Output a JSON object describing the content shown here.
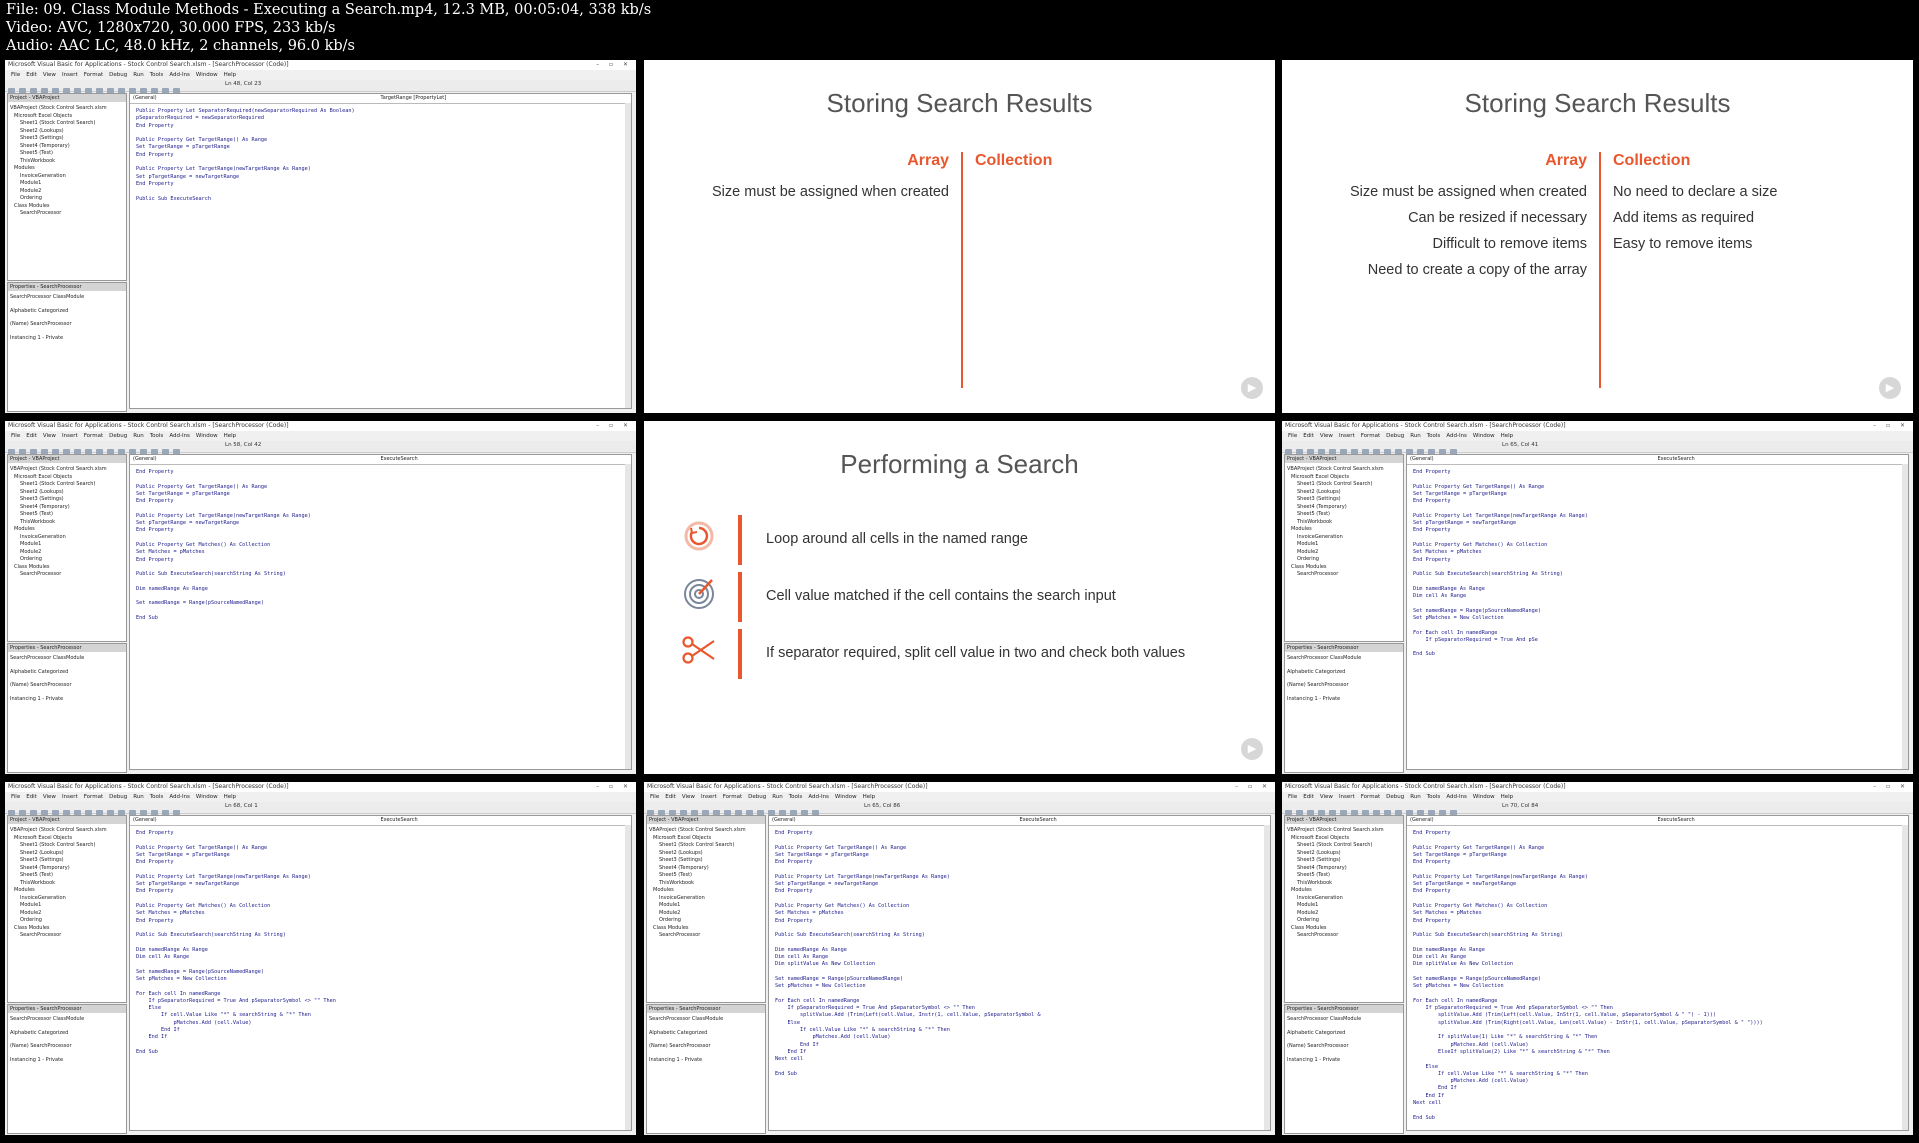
{
  "header": {
    "file": "File: 09. Class Module Methods - Executing a Search.mp4, 12.3 MB, 00:05:04, 338 kb/s",
    "video": "Video: AVC, 1280x720, 30.000 FPS, 233 kb/s",
    "audio": "Audio: AAC LC, 48.0 kHz, 2 channels, 96.0 kb/s"
  },
  "editor": {
    "title": "Microsoft Visual Basic for Applications - Stock Control Search.xlsm - [SearchProcessor (Code)]",
    "menu": [
      "File",
      "Edit",
      "View",
      "Insert",
      "Format",
      "Debug",
      "Run",
      "Tools",
      "Add-Ins",
      "Window",
      "Help"
    ],
    "project_title": "Project - VBAProject",
    "tree": [
      "VBAProject (Stock Control Search.xlsm",
      "Microsoft Excel Objects",
      "Sheet1 (Stock Control Search)",
      "Sheet2 (Lookups)",
      "Sheet3 (Settings)",
      "Sheet4 (Temporary)",
      "Sheet5 (Test)",
      "ThisWorkbook",
      "Modules",
      "InvoiceGeneration",
      "Module1",
      "Module2",
      "Ordering",
      "Class Modules",
      "SearchProcessor"
    ],
    "props_title": "Properties - SearchProcessor",
    "props_object": "SearchProcessor ClassModule",
    "props_tabs": "Alphabetic  Categorized",
    "props_rows": [
      "(Name)     SearchProcessor",
      "Instancing  1 - Private"
    ]
  },
  "tiles": [
    {
      "pos": "Ln 48, Col 23",
      "left_dd": "(General)",
      "right_dd": "TargetRange [PropertyLet]",
      "code": "Public Property Let SeparatorRequired(newSeparatorRequired As Boolean)\npSeparatorRequired = newSeparatorRequired\nEnd Property\n\nPublic Property Get TargetRange() As Range\nSet TargetRange = pTargetRange\nEnd Property\n\nPublic Property Let TargetRange(newTargetRange As Range)\nSet pTargetRange = newTargetRange\nEnd Property\n\nPublic Sub ExecuteSearch"
    },
    {
      "pos": "Ln 58, Col 42",
      "left_dd": "(General)",
      "right_dd": "ExecuteSearch",
      "code": "End Property\n\nPublic Property Get TargetRange() As Range\nSet TargetRange = pTargetRange\nEnd Property\n\nPublic Property Let TargetRange(newTargetRange As Range)\nSet pTargetRange = newTargetRange\nEnd Property\n\nPublic Property Get Matches() As Collection\nSet Matches = pMatches\nEnd Property\n\nPublic Sub ExecuteSearch(searchString As String)\n\nDim namedRange As Range\n\nSet namedRange = Range(pSourceNamedRange)\n\nEnd Sub"
    },
    {
      "pos": "Ln 65, Col 41",
      "left_dd": "(General)",
      "right_dd": "ExecuteSearch",
      "code": "End Property\n\nPublic Property Get TargetRange() As Range\nSet TargetRange = pTargetRange\nEnd Property\n\nPublic Property Let TargetRange(newTargetRange As Range)\nSet pTargetRange = newTargetRange\nEnd Property\n\nPublic Property Get Matches() As Collection\nSet Matches = pMatches\nEnd Property\n\nPublic Sub ExecuteSearch(searchString As String)\n\nDim namedRange As Range\nDim cell As Range\n\nSet namedRange = Range(pSourceNamedRange)\nSet pMatches = New Collection\n\nFor Each cell In namedRange\n    If pSeparatorRequired = True And pSe\n\nEnd Sub"
    },
    {
      "pos": "Ln 68, Col 1",
      "left_dd": "(General)",
      "right_dd": "ExecuteSearch",
      "code": "End Property\n\nPublic Property Get TargetRange() As Range\nSet TargetRange = pTargetRange\nEnd Property\n\nPublic Property Let TargetRange(newTargetRange As Range)\nSet pTargetRange = newTargetRange\nEnd Property\n\nPublic Property Get Matches() As Collection\nSet Matches = pMatches\nEnd Property\n\nPublic Sub ExecuteSearch(searchString As String)\n\nDim namedRange As Range\nDim cell As Range\n\nSet namedRange = Range(pSourceNamedRange)\nSet pMatches = New Collection\n\nFor Each cell In namedRange\n    If pSeparatorRequired = True And pSeparatorSymbol <> \"\" Then\n    Else\n        If cell.Value Like \"*\" & searchString & \"*\" Then\n            pMatches.Add (cell.Value)\n        End If\n    End If\n\nEnd Sub"
    },
    {
      "pos": "Ln 65, Col 86",
      "left_dd": "(General)",
      "right_dd": "ExecuteSearch",
      "code": "End Property\n\nPublic Property Get TargetRange() As Range\nSet TargetRange = pTargetRange\nEnd Property\n\nPublic Property Let TargetRange(newTargetRange As Range)\nSet pTargetRange = newTargetRange\nEnd Property\n\nPublic Property Get Matches() As Collection\nSet Matches = pMatches\nEnd Property\n\nPublic Sub ExecuteSearch(searchString As String)\n\nDim namedRange As Range\nDim cell As Range\nDim splitValue As New Collection\n\nSet namedRange = Range(pSourceNamedRange)\nSet pMatches = New Collection\n\nFor Each cell In namedRange\n    If pSeparatorRequired = True And pSeparatorSymbol <> \"\" Then\n        splitValue.Add (Trim(Left(cell.Value, Instr(1, cell.Value, pSeparatorSymbol &\n    Else\n        If cell.Value Like \"*\" & searchString & \"*\" Then\n            pMatches.Add (cell.Value)\n        End If\n    End If\nNext cell\n\nEnd Sub"
    },
    {
      "pos": "Ln 70, Col 84",
      "left_dd": "(General)",
      "right_dd": "ExecuteSearch",
      "code": "End Property\n\nPublic Property Get TargetRange() As Range\nSet TargetRange = pTargetRange\nEnd Property\n\nPublic Property Let TargetRange(newTargetRange As Range)\nSet pTargetRange = newTargetRange\nEnd Property\n\nPublic Property Get Matches() As Collection\nSet Matches = pMatches\nEnd Property\n\nPublic Sub ExecuteSearch(searchString As String)\n\nDim namedRange As Range\nDim cell As Range\nDim splitValue As New Collection\n\nSet namedRange = Range(pSourceNamedRange)\nSet pMatches = New Collection\n\nFor Each cell In namedRange\n    If pSeparatorRequired = True And pSeparatorSymbol <> \"\" Then\n        splitValue.Add (Trim(Left(cell.Value, InStr(1, cell.Value, pSeparatorSymbol & \" \") - 1)))\n        splitValue.Add (Trim(Right(cell.Value, Len(cell.Value) - InStr(1, cell.Value, pSeparatorSymbol & \" \"))))\n\n        If splitValue(1) Like \"*\" & searchString & \"*\" Then\n            pMatches.Add (cell.Value)\n        ElseIf splitValue(2) Like \"*\" & searchString & \"*\" Then\n\n    Else\n        If cell.Value Like \"*\" & searchString & \"*\" Then\n            pMatches.Add (cell.Value)\n        End If\n    End If\nNext cell\n\nEnd Sub"
    }
  ],
  "slides": {
    "storing": {
      "title": "Storing Search Results",
      "array": "Array",
      "collection": "Collection",
      "array_rows": [
        "Size must be assigned when created",
        "Can be resized if necessary",
        "Difficult to remove items",
        "Need to create a copy of the array"
      ],
      "collection_rows": [
        "No need to declare a size",
        "Add items as required",
        "Easy to remove items"
      ]
    },
    "perform": {
      "title": "Performing a Search",
      "rows": [
        {
          "icon": "loop-icon",
          "text": "Loop around all cells in the named range"
        },
        {
          "icon": "target-icon",
          "text": "Cell value matched if the cell contains the search input"
        },
        {
          "icon": "scissors-icon",
          "text": "If separator required, split cell value in two and check both values"
        }
      ]
    }
  },
  "colors": {
    "accent": "#e8572d",
    "code_text": "#1a1a8c"
  }
}
